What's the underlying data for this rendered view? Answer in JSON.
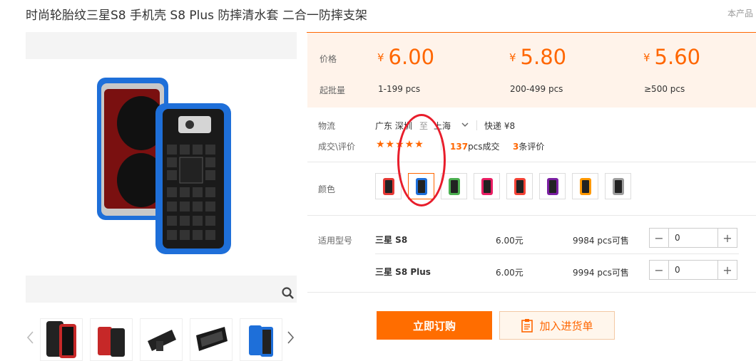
{
  "product": {
    "title": "时尚轮胎纹三星S8 手机壳 S8 Plus 防摔清水套 二合一防摔支架",
    "side_note": "本产品"
  },
  "pricing": {
    "price_label": "价格",
    "moq_label": "起批量",
    "currency": "¥",
    "tiers": [
      {
        "price": "6.00",
        "range": "1-199 pcs"
      },
      {
        "price": "5.80",
        "range": "200-499 pcs"
      },
      {
        "price": "5.60",
        "range": "≥500 pcs"
      }
    ]
  },
  "logistics": {
    "label": "物流",
    "from": "广东 深圳",
    "to_word": "至",
    "dest": "上海",
    "express": "快递 ¥8"
  },
  "reviews": {
    "label": "成交\\评价",
    "stars": "★★★★★",
    "deals_count": "137",
    "deals_suffix": "pcs成交",
    "review_count": "3",
    "review_suffix": "条评价"
  },
  "color": {
    "label": "颜色",
    "swatches": [
      {
        "accent": "#e53935"
      },
      {
        "accent": "#1e6fd9"
      },
      {
        "accent": "#4caf50"
      },
      {
        "accent": "#e91e63"
      },
      {
        "accent": "#f44336"
      },
      {
        "accent": "#7b1fa2"
      },
      {
        "accent": "#ff9800"
      },
      {
        "accent": "#9e9e9e"
      }
    ],
    "selected_index": 1
  },
  "models": {
    "label": "适用型号",
    "rows": [
      {
        "name": "三星 S8",
        "price": "6.00元",
        "stock": "9984 pcs可售",
        "qty": "0"
      },
      {
        "name": "三星 S8 Plus",
        "price": "6.00元",
        "stock": "9994 pcs可售",
        "qty": "0"
      }
    ]
  },
  "actions": {
    "buy": "立即订购",
    "cart": "加入进货单"
  },
  "colors": {
    "accent": "#ff6600",
    "case_blue": "#1e6fd9"
  }
}
